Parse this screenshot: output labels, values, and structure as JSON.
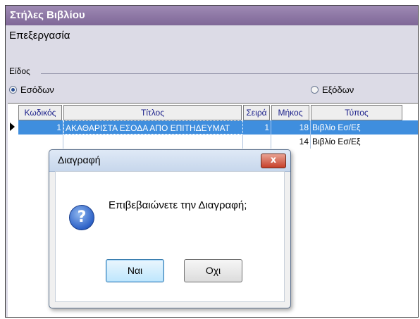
{
  "window": {
    "title": "Στήλες Βιβλίου"
  },
  "section": {
    "label": "Επεξεργασία"
  },
  "type_group": {
    "label": "Είδος",
    "options": [
      {
        "label": "Εσόδων",
        "selected": true
      },
      {
        "label": "Εξόδων",
        "selected": false
      }
    ]
  },
  "grid": {
    "columns": [
      "Κωδικός",
      "Τίτλος",
      "Σειρά",
      "Μήκος",
      "Τύπος"
    ],
    "rows": [
      {
        "code": "1",
        "title": "ΑΚΑΘΑΡΙΣΤΑ ΕΣΟΔΑ ΑΠΟ ΕΠΙΤΗΔΕΥΜΑΤ",
        "order": "1",
        "length": "18",
        "type": "Βιβλίο Εσ/Εξ",
        "selected": true
      },
      {
        "code": "",
        "title": "",
        "order": "",
        "length": "14",
        "type": "Βιβλίο Εσ/Εξ",
        "selected": false
      }
    ]
  },
  "dialog": {
    "title": "Διαγραφή",
    "close_label": "x",
    "icon": "question-icon",
    "message": "Επιβεβαιώνετε την Διαγραφή;",
    "yes_label": "Ναι",
    "no_label": "Οχι"
  },
  "colors": {
    "titlebar": "#8f78a8",
    "selection": "#3f8ede",
    "header_text": "#1a1f8a"
  }
}
